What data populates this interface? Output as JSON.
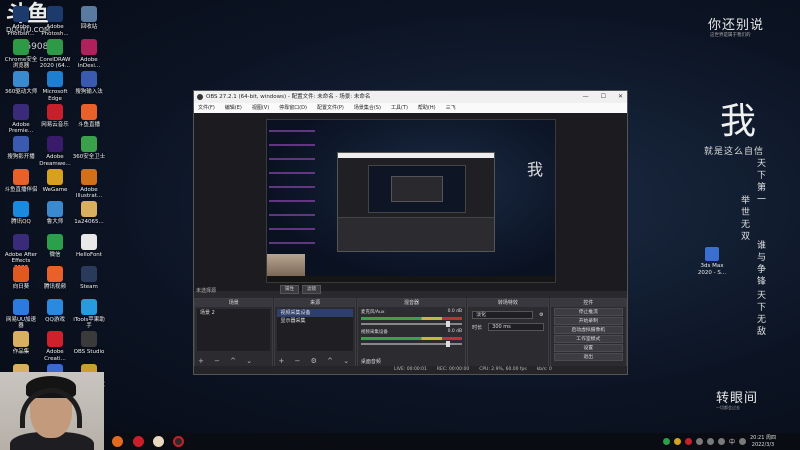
{
  "watermark": {
    "logo": "斗鱼",
    "site": "DOUYU.COM",
    "room_id": "485908"
  },
  "desktop_icons": [
    {
      "label": "Adobe Photosh...",
      "color": "#1c3a6b"
    },
    {
      "label": "Adobe Photosh...",
      "color": "#1c3a6b"
    },
    {
      "label": "回收站",
      "color": "#5a7aa0"
    },
    {
      "label": "Chrome安全浏览器",
      "color": "#2f9a46"
    },
    {
      "label": "CorelDRAW 2020 (64...",
      "color": "#2f9a46"
    },
    {
      "label": "Adobe InDesi...",
      "color": "#b0205a"
    },
    {
      "label": "360驱动大师",
      "color": "#3a8ad0"
    },
    {
      "label": "Microsoft Edge",
      "color": "#1e7fd0"
    },
    {
      "label": "搜狗输入法",
      "color": "#3a5ab0"
    },
    {
      "label": "Adobe Premie...",
      "color": "#3a2a7a"
    },
    {
      "label": "网易云音乐",
      "color": "#c8202a"
    },
    {
      "label": "斗鱼直播",
      "color": "#e8602a"
    },
    {
      "label": "搜狗影开播",
      "color": "#3a5ab0"
    },
    {
      "label": "Adobe Dreamwe...",
      "color": "#3a1a6a"
    },
    {
      "label": "360安全卫士",
      "color": "#3aa04a"
    },
    {
      "label": "斗鱼直播伴侣",
      "color": "#e8602a"
    },
    {
      "label": "WeGame",
      "color": "#d8a020"
    },
    {
      "label": "Adobe Illustrat...",
      "color": "#d0701a"
    },
    {
      "label": "腾讯QQ",
      "color": "#1a8ae0"
    },
    {
      "label": "鲁大师",
      "color": "#3a8ad0"
    },
    {
      "label": "1a24065...",
      "color": "#d8b060"
    },
    {
      "label": "Adobe After Effects 2020",
      "color": "#3a2a7a"
    },
    {
      "label": "微信",
      "color": "#2aa04a"
    },
    {
      "label": "HelloFont",
      "color": "#e8e8e8"
    },
    {
      "label": "向日葵",
      "color": "#e05a20"
    },
    {
      "label": "腾讯视频",
      "color": "#e8602a"
    },
    {
      "label": "Steam",
      "color": "#2a3a5a"
    },
    {
      "label": "网易UU加速器",
      "color": "#2a7ae0"
    },
    {
      "label": "QQ游戏",
      "color": "#2a8ae0"
    },
    {
      "label": "iTools苹果助手",
      "color": "#2a9ae0"
    },
    {
      "label": "作品集",
      "color": "#d8b060"
    },
    {
      "label": "Adobe Creati...",
      "color": "#d0202a"
    },
    {
      "label": "OBS Studio",
      "color": "#3a3a3a"
    },
    {
      "label": "面试作品",
      "color": "#d8b060"
    },
    {
      "label": "360压缩",
      "color": "#3a6ad0"
    },
    {
      "label": "CFHD高清竞技大区",
      "color": "#c8a030"
    }
  ],
  "right_icon": {
    "label": "3ds Max 2020 - S..."
  },
  "calligraphy": {
    "top": "你还别说",
    "sub": "这世界是属于我们的",
    "wo": "我",
    "line": "就是这么自信",
    "col1": "天下第一",
    "col2": "举世无双",
    "col3": "谁与争锋",
    "col4": "天下无敌",
    "bottom": "转眼间",
    "bottom_sub": "一切都会过去"
  },
  "obs": {
    "title": "OBS 27.2.1 (64-bit, windows) - 配置文件: 未命名 - 场景: 未命名",
    "window_buttons": [
      "—",
      "☐",
      "✕"
    ],
    "menu": [
      "文件(F)",
      "编辑(E)",
      "视图(V)",
      "停靠窗口(D)",
      "配置文件(P)",
      "场景集合(S)",
      "工具(T)",
      "帮助(H)",
      "三飞"
    ],
    "no_source": "未选择源",
    "source_buttons": [
      "属性",
      "滤镜"
    ],
    "docks": {
      "scenes": {
        "title": "场景",
        "items": [
          "场景 2"
        ]
      },
      "sources": {
        "title": "来源",
        "items": [
          "视频采集设备",
          "显示器采集"
        ]
      },
      "mixer": {
        "title": "混音器",
        "channels": [
          {
            "name": "麦克风/Aux",
            "db": "0.0 dB"
          },
          {
            "name": "视频采集设备",
            "db": "0.0 dB"
          }
        ],
        "footer": "桌面音频"
      },
      "transitions": {
        "title": "转场特效",
        "type": "淡化",
        "duration_label": "时长",
        "duration": "300 ms"
      },
      "controls": {
        "title": "控件",
        "buttons": [
          "停止推流",
          "开始录制",
          "启动虚拟摄像机",
          "工作室模式",
          "设置",
          "退出"
        ]
      }
    },
    "status": [
      "LIVE: 00:00:01",
      "REC: 00:00:00",
      "CPU: 2.9%, 60.00 fps",
      "kb/s: 0"
    ]
  },
  "taskbar": {
    "clock_time": "20:21 周四",
    "clock_date": "2022/3/3",
    "tray_lang": "中"
  }
}
